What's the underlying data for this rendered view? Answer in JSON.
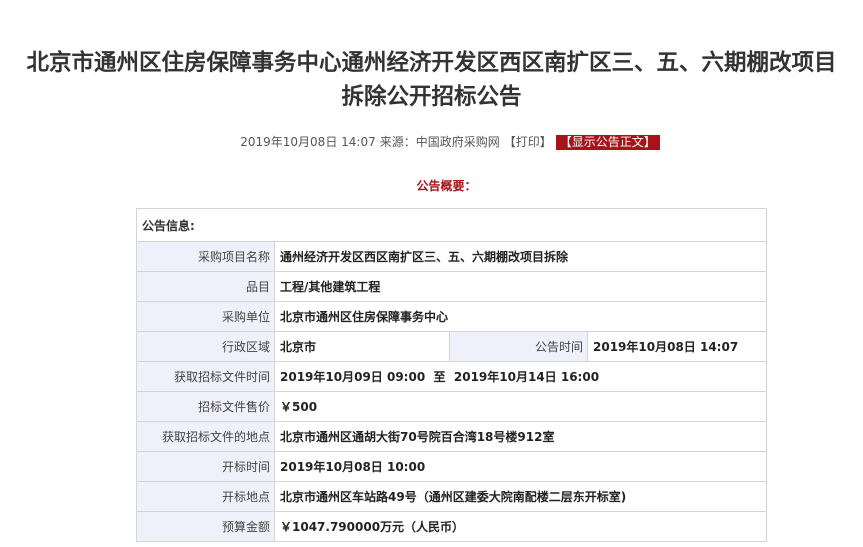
{
  "title": {
    "line1": "北京市通州区住房保障事务中心通州经济开发区西区南扩区三、五、六期棚改项目",
    "line2": "拆除公开招标公告"
  },
  "meta": {
    "datetime": "2019年10月08日 14:07",
    "source": "来源：中国政府采购网",
    "print_label": "【打印】",
    "show_label": "【显示公告正文】"
  },
  "overview_label": "公告概要：",
  "table": {
    "header": "公告信息:",
    "project_name_label": "采购项目名称",
    "project_name": "通州经济开发区西区南扩区三、五、六期棚改项目拆除",
    "category_label": "品目",
    "category": "工程/其他建筑工程",
    "buyer_label": "采购单位",
    "buyer": "北京市通州区住房保障事务中心",
    "region_label": "行政区域",
    "region": "北京市",
    "announce_time_label": "公告时间",
    "announce_time": "2019年10月08日 14:07",
    "obtain_time_label": "获取招标文件时间",
    "obtain_time": "2019年10月09日 09:00  至  2019年10月14日 16:00",
    "doc_price_label": "招标文件售价",
    "doc_price": "￥500",
    "obtain_place_label": "获取招标文件的地点",
    "obtain_place": "北京市通州区通胡大街70号院百合湾18号楼912室",
    "open_time_label": "开标时间",
    "open_time": "2019年10月08日 10:00",
    "open_place_label": "开标地点",
    "open_place": "北京市通州区车站路49号（通州区建委大院南配楼二层东开标室)",
    "budget_label": "预算金额",
    "budget": "￥1047.790000万元（人民币）"
  }
}
